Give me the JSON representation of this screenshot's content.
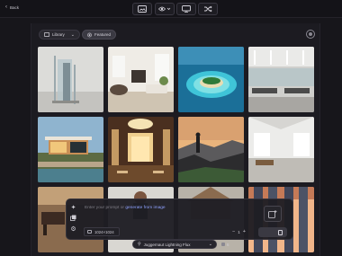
{
  "topbar": {
    "back_label": "Back",
    "icons": [
      "gallery-icon",
      "eye-icon",
      "chevron-down-icon",
      "canvas-icon",
      "shuffle-icon"
    ]
  },
  "filters": {
    "library_label": "Library",
    "featured_label": "Featured"
  },
  "gallery": {
    "images": [
      "glass-sculpture-in-gallery",
      "modern-living-room",
      "tropical-island-aerial",
      "open-office-interior",
      "modern-villa-exterior",
      "luxury-hotel-lobby",
      "man-on-mountain-cliff",
      "empty-white-loft",
      "lounge-chair-interior",
      "man-portrait",
      "wooden-cabin-gable",
      "skyscraper-sunset"
    ]
  },
  "prompt": {
    "placeholder": "Enter your prompt or",
    "link": "generate from image",
    "size_label": "1024×1024",
    "count": "1"
  },
  "model": {
    "name": "Juggernaut Lightning Flux",
    "credits": "6"
  }
}
